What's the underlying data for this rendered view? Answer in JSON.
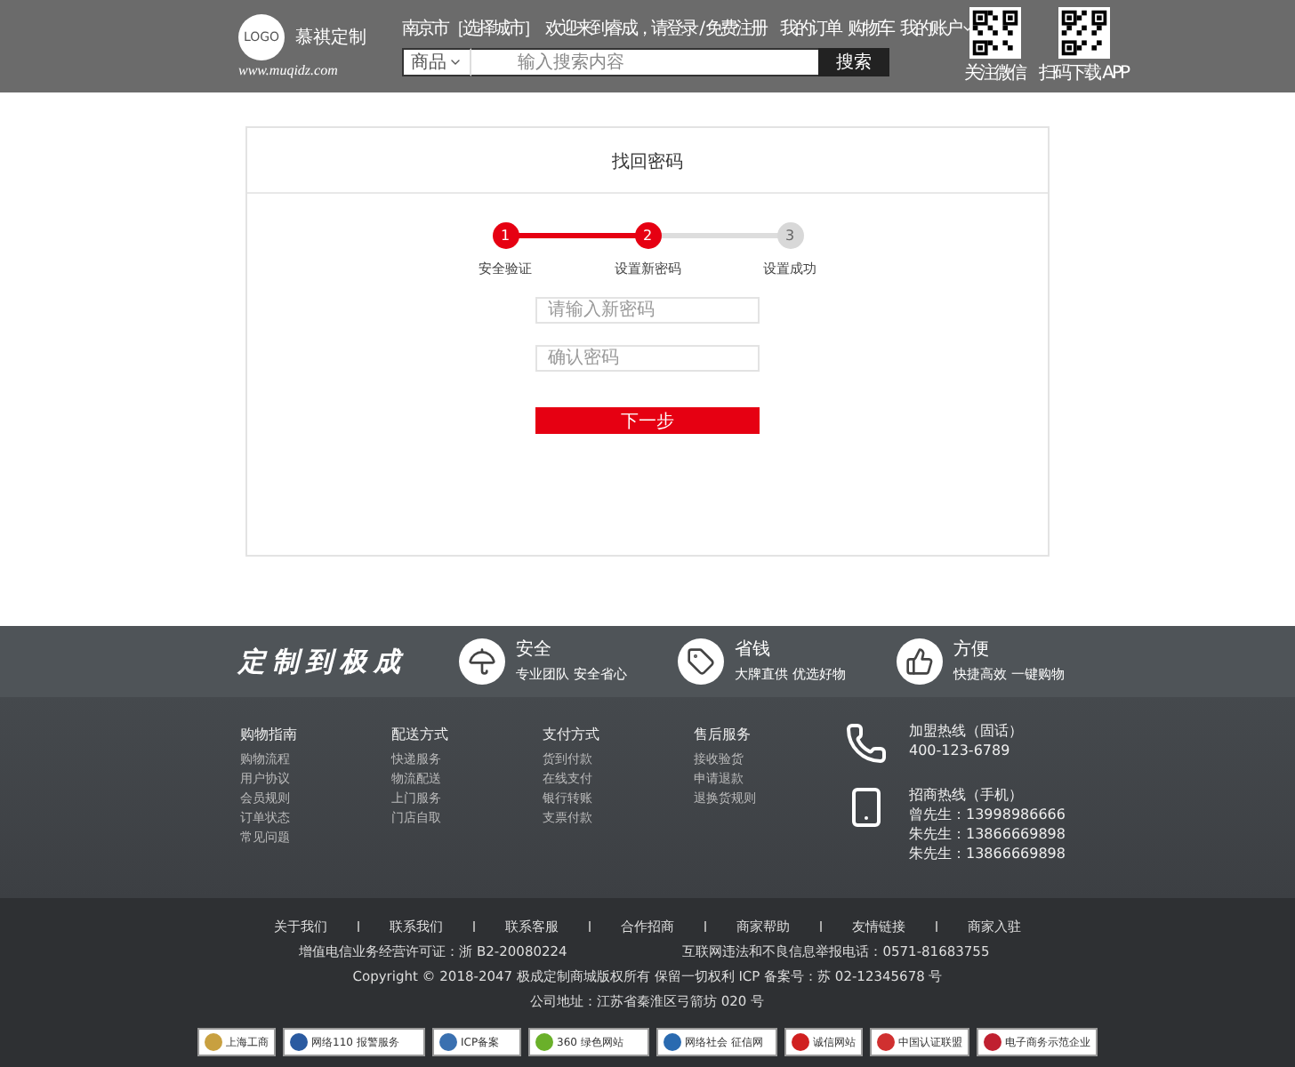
{
  "header": {
    "logo": "LOGO",
    "brand": "慕祺定制",
    "site_url": "www.muqidz.com",
    "city": "南京市［选择城市］",
    "welcome": "欢迎来到睿成，请登录 / 免费注册",
    "top_links": [
      {
        "label": "我的订单",
        "has_menu": false
      },
      {
        "label": "购物车",
        "has_menu": false
      },
      {
        "label": "我的账户",
        "has_menu": true
      }
    ],
    "search": {
      "category": "商品",
      "placeholder": "输入搜索内容",
      "button": "搜索"
    },
    "qr_codes": [
      {
        "caption": "关注微信"
      },
      {
        "caption": "扫码下载 APP"
      }
    ]
  },
  "card": {
    "title": "找回密码",
    "steps": [
      {
        "number": "1",
        "label": "安全验证",
        "done": true
      },
      {
        "number": "2",
        "label": "设置新密码",
        "done": true
      },
      {
        "number": "3",
        "label": "设置成功",
        "done": false
      }
    ],
    "fields": [
      {
        "placeholder": "请输入新密码"
      },
      {
        "placeholder": "确认密码"
      }
    ],
    "button": "下一步"
  },
  "features": {
    "slogan": "定制到极成",
    "items": [
      {
        "kind": "umbrella",
        "title": "安全",
        "subtitle": "专业团队 安全省心"
      },
      {
        "kind": "tag",
        "title": "省钱",
        "subtitle": "大牌直供 优选好物"
      },
      {
        "kind": "thumb",
        "title": "方便",
        "subtitle": "快捷高效 一键购物"
      }
    ]
  },
  "link_columns": [
    {
      "heading": "购物指南",
      "links": [
        "购物流程",
        "用户协议",
        "会员规则",
        "订单状态",
        "常见问题"
      ]
    },
    {
      "heading": "配送方式",
      "links": [
        "快递服务",
        "物流配送",
        "上门服务",
        "门店自取"
      ]
    },
    {
      "heading": "支付方式",
      "links": [
        "货到付款",
        "在线支付",
        "银行转账",
        "支票付款"
      ]
    },
    {
      "heading": "售后服务",
      "links": [
        "接收验货",
        "申请退款",
        "退换货规则"
      ]
    }
  ],
  "hotlines": [
    {
      "kind": "landline",
      "title": "加盟热线（固话）",
      "lines": [
        "400-123-6789"
      ]
    },
    {
      "kind": "mobile",
      "title": "招商热线（手机）",
      "lines": [
        "曾先生：13998986666",
        "朱先生：13866669898",
        "朱先生：13866669898"
      ]
    }
  ],
  "bottom": {
    "links": [
      "关于我们",
      "联系我们",
      "联系客服",
      "合作招商",
      "商家帮助",
      "友情链接",
      "商家入驻"
    ],
    "license": "增值电信业务经营许可证：浙 B2-20080224",
    "report": "互联网违法和不良信息举报电话：0571-81683755",
    "copyright": "Copyright © 2018-2047 极成定制商城版权所有 保留一切权利 ICP 备案号：苏 02-12345678 号",
    "address": "公司地址：江苏省秦淮区弓箭坊 020 号",
    "badges": [
      {
        "label": "上海工商",
        "color": "#c8a040"
      },
      {
        "label": "网络110 报警服务",
        "color": "#2a5aa0"
      },
      {
        "label": "ICP备案",
        "color": "#3a70b0"
      },
      {
        "label": "360 绿色网站",
        "color": "#6ab02a"
      },
      {
        "label": "网络社会 征信网",
        "color": "#2a6ab0"
      },
      {
        "label": "诚信网站",
        "color": "#d02020"
      },
      {
        "label": "中国认证联盟",
        "color": "#d03030"
      },
      {
        "label": "电子商务示范企业",
        "color": "#c02030"
      }
    ]
  }
}
